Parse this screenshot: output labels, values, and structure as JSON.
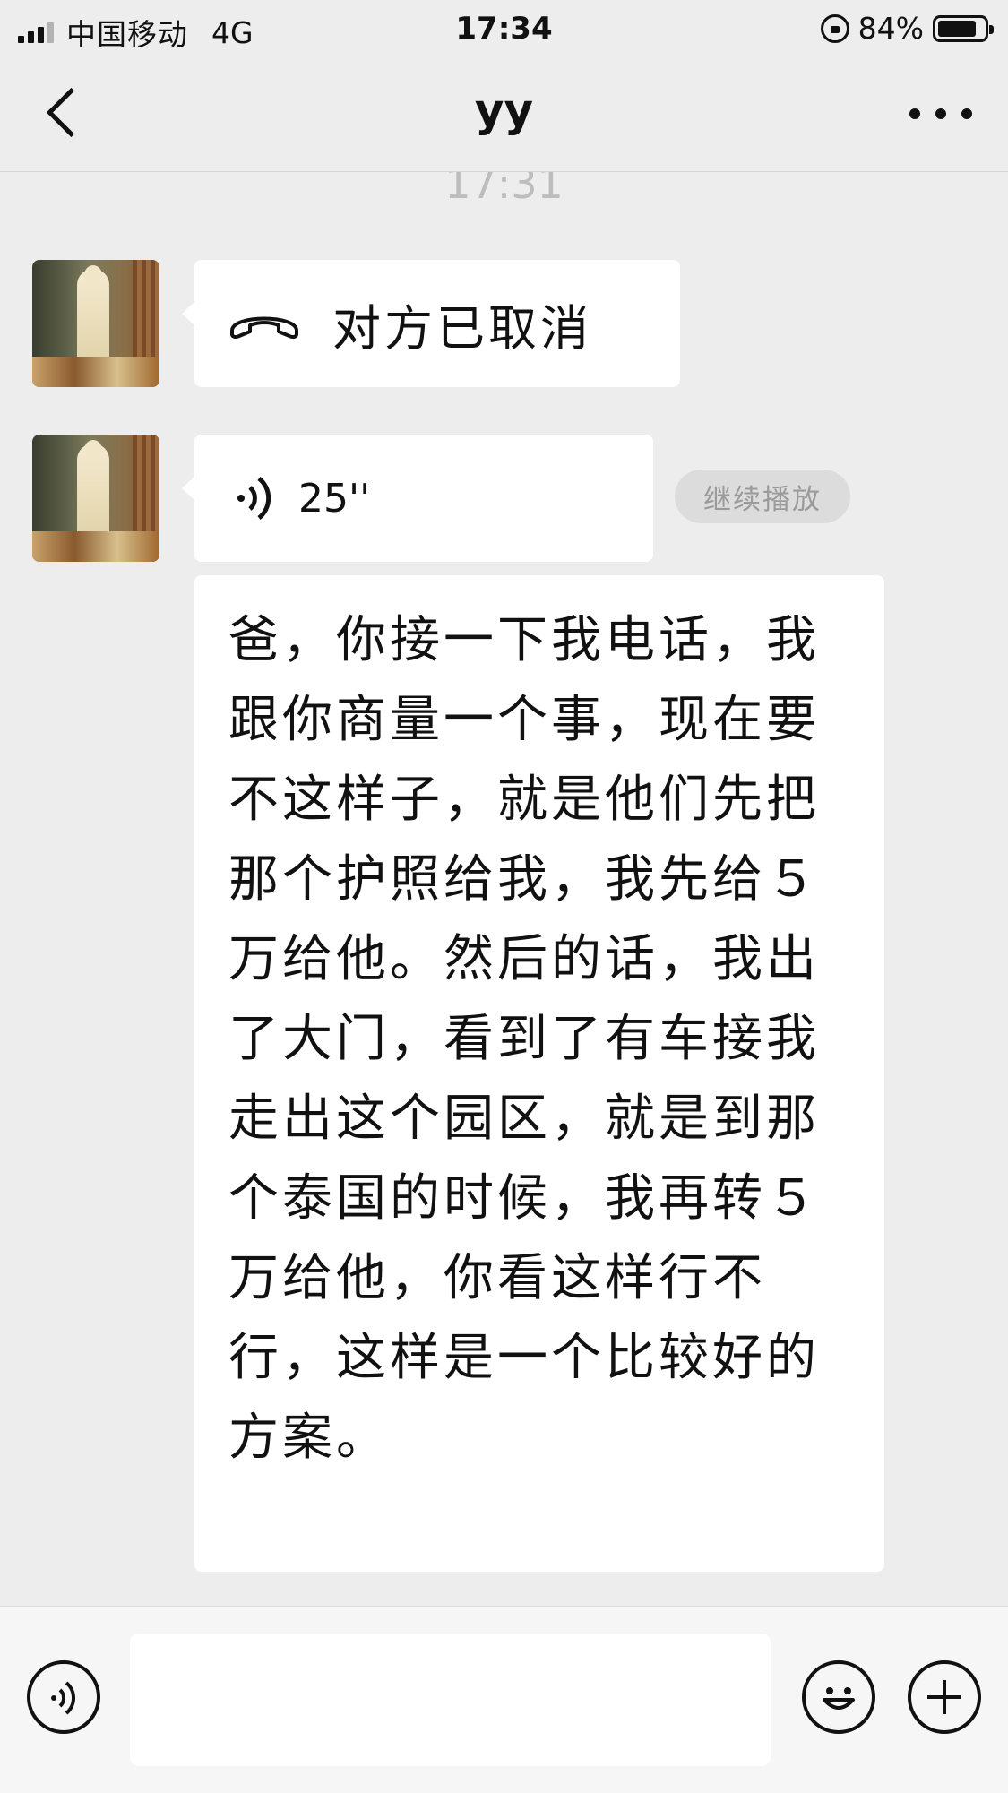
{
  "status_bar": {
    "carrier": "中国移动",
    "network": "4G",
    "time": "17:34",
    "battery_percent": "84%",
    "battery_level": 0.84
  },
  "nav": {
    "title": "yy",
    "back_icon": "chevron-left-icon",
    "more_icon": "more-dots-icon"
  },
  "chat": {
    "timestamp": "17:31",
    "messages": [
      {
        "type": "call",
        "icon": "hang-up-phone-icon",
        "text": "对方已取消"
      },
      {
        "type": "voice",
        "icon": "voice-wave-icon",
        "duration": "25''",
        "action": "继续播放"
      },
      {
        "type": "text",
        "text": "爸，你接一下我电话，我跟你商量一个事，现在要不这样子，就是他们先把那个护照给我，我先给５万给他。然后的话，我出了大门，看到了有车接我走出这个园区，就是到那个泰国的时候，我再转５万给他，你看这样行不行，这样是一个比较好的方案。"
      }
    ]
  },
  "input_bar": {
    "voice_icon": "voice-input-icon",
    "input_value": "",
    "emoji_icon": "emoji-icon",
    "plus_icon": "plus-icon"
  }
}
